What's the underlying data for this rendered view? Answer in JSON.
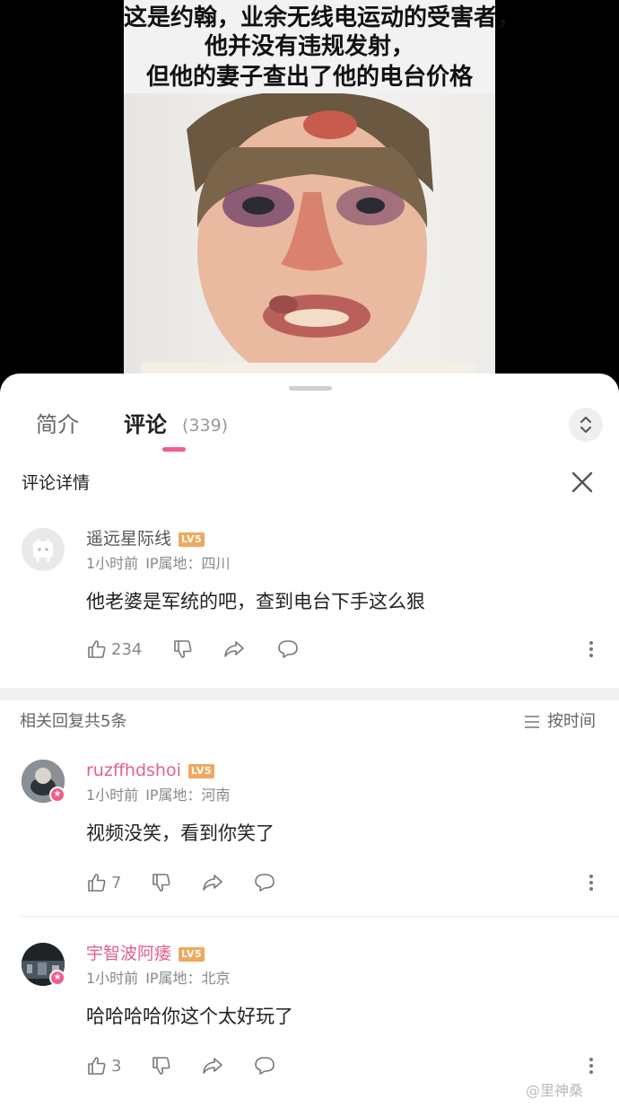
{
  "video": {
    "caption_lines": [
      "这是约翰，业余无线电运动的受害者，",
      "他并没有违规发射，",
      "但他的妻子查出了他的电台价格"
    ]
  },
  "tabs": {
    "intro_label": "简介",
    "comments_label": "评论",
    "comments_count": "(339)"
  },
  "detail": {
    "title": "评论详情"
  },
  "main_comment": {
    "username": "遥远星际线",
    "level": "LV5",
    "time": "1小时前",
    "ip": "IP属地：四川",
    "text": "他老婆是军统的吧，查到电台下手这么狠",
    "likes": "234"
  },
  "replies": {
    "header": "相关回复共5条",
    "sort_label": "按时间",
    "items": [
      {
        "username": "ruzffhdshoi",
        "level": "LV5",
        "time": "1小时前",
        "ip": "IP属地：河南",
        "text": "视频没笑，看到你笑了",
        "likes": "7"
      },
      {
        "username": "宇智波阿痿",
        "level": "LV5",
        "time": "1小时前",
        "ip": "IP属地：北京",
        "text": "哈哈哈哈你这个太好玩了",
        "likes": "3"
      }
    ]
  },
  "watermark": "@里神桑",
  "colors": {
    "accent_pink": "#f25d8e",
    "level_badge": "#f0a85e",
    "vip_name": "#e2608f"
  }
}
